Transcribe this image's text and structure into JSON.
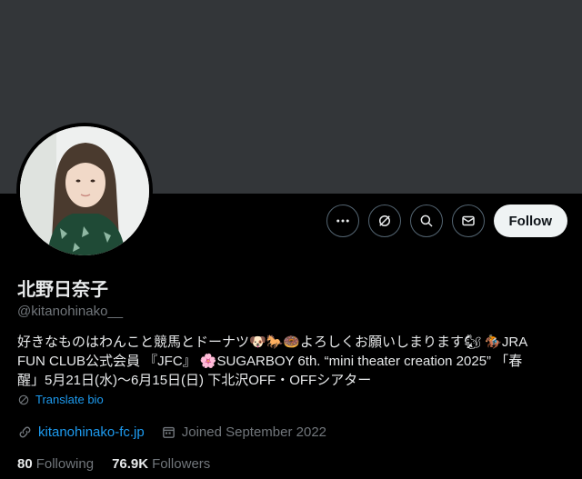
{
  "profile": {
    "name": "北野日奈子",
    "handle": "@kitanohinako__",
    "bio_line1": "好きなものはわんこと競馬とドーナツ🐶🐎🍩よろしくお願いしまります🐿 🏇JRA",
    "bio_line2": "FUN CLUB公式会員 『JFC』 🌸SUGARBOY 6th. “mini theater creation 2025” 「春",
    "bio_line3": "醒」5月21日(水)〜6月15日(日) 下北沢OFF・OFFシアター",
    "translate_label": "Translate bio",
    "website": "kitanohinako-fc.jp",
    "joined": "Joined September 2022"
  },
  "actions": {
    "follow_label": "Follow"
  },
  "stats": {
    "following_count": "80",
    "following_label": "Following",
    "followers_count": "76.9K",
    "followers_label": "Followers"
  },
  "colors": {
    "background": "#000000",
    "banner": "#333639",
    "accent": "#1d9bf0",
    "muted": "#71767b"
  },
  "icons": [
    "more-icon",
    "grok-icon",
    "search-icon",
    "mail-icon",
    "translate-icon",
    "link-icon",
    "calendar-icon"
  ]
}
